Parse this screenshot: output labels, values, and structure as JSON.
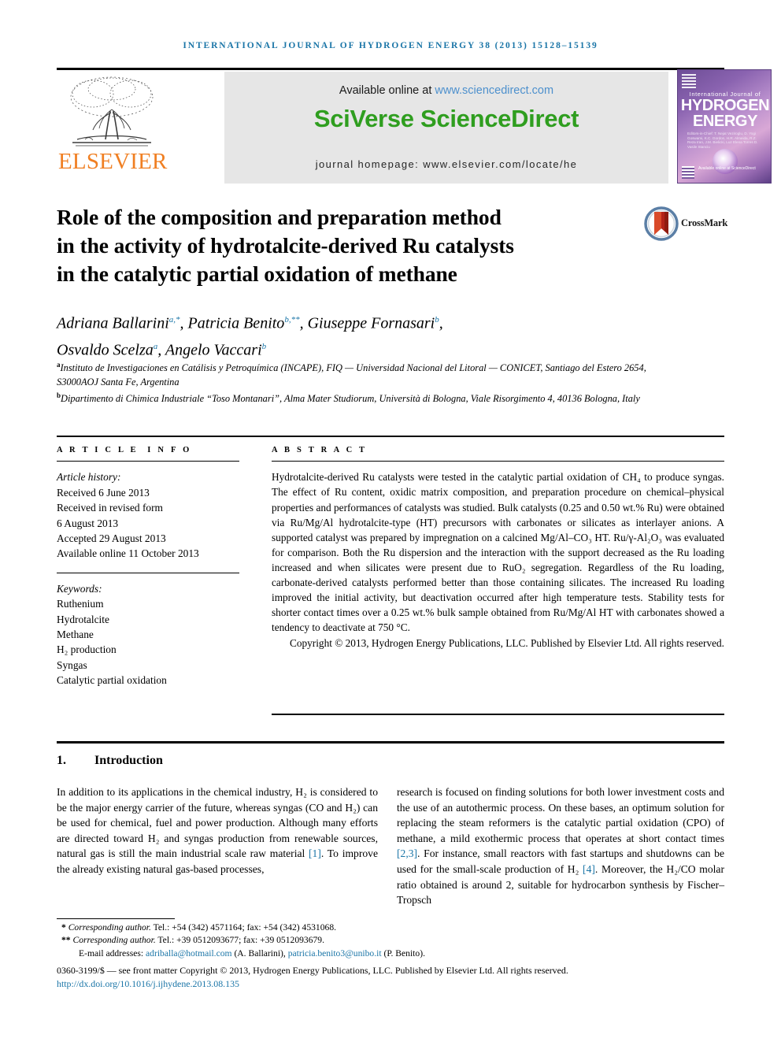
{
  "running_head": "International Journal of Hydrogen Energy 38 (2013) 15128–15139",
  "masthead": {
    "publisher_wordmark": "ELSEVIER",
    "available_label": "Available online at",
    "available_url": "www.sciencedirect.com",
    "platform_name": "SciVerse ScienceDirect",
    "homepage_line": "journal homepage: www.elsevier.com/locate/he",
    "cover": {
      "line1": "International Journal of",
      "line2": "HYDROGEN",
      "line3": "ENERGY",
      "editors": "Editors-in-Chief: T. Nejat Veziroglu, D. Yogi Goswami, K.C. Gordon, H.R. Almeida, R.Z. Reza Iran, J.M. Bielicki, Luz Elena Torres D. Vasile Stanciu",
      "publisher_note": "Available online at ScienceDirect"
    },
    "colors": {
      "elsevier_orange": "#F07F22",
      "sciverse_green": "#2f9e1f",
      "link_blue": "#4d90cd",
      "running_head_blue": "#1a75a7",
      "banner_gray": "#e6e6e6"
    }
  },
  "article": {
    "title_line1": "Role of the composition and preparation method",
    "title_line2": "in the activity of hydrotalcite-derived Ru catalysts",
    "title_line3": "in the catalytic partial oxidation of methane",
    "crossmark_label": "CrossMark",
    "authors_line1": "Adriana Ballarini",
    "authors_sup1": "a,*",
    "authors_line1b": ", Patricia Benito",
    "authors_sup2": "b,**",
    "authors_line1c": ", Giuseppe Fornasari",
    "authors_sup3": "b",
    "authors_line2": "Osvaldo Scelza",
    "authors_sup4": "a",
    "authors_line2b": ", Angelo Vaccari",
    "authors_sup5": "b",
    "affiliation_a_mark": "a",
    "affiliation_a": "Instituto de Investigaciones en Catálisis y Petroquímica (INCAPE), FIQ — Universidad Nacional del Litoral — CONICET, Santiago del Estero 2654, S3000AOJ Santa Fe, Argentina",
    "affiliation_b_mark": "b",
    "affiliation_b": "Dipartimento di Chimica Industriale “Toso Montanari”, Alma Mater Studiorum, Università di Bologna, Viale Risorgimento 4, 40136 Bologna, Italy"
  },
  "info": {
    "heading": "ARTICLE INFO",
    "history_label": "Article history:",
    "history": [
      "Received 6 June 2013",
      "Received in revised form",
      "6 August 2013",
      "Accepted 29 August 2013",
      "Available online 11 October 2013"
    ],
    "keywords_label": "Keywords:",
    "keywords": [
      "Ruthenium",
      "Hydrotalcite",
      "Methane",
      "H₂ production",
      "Syngas",
      "Catalytic partial oxidation"
    ]
  },
  "abstract": {
    "heading": "ABSTRACT",
    "text": "Hydrotalcite-derived Ru catalysts were tested in the catalytic partial oxidation of CH₄ to produce syngas. The effect of Ru content, oxidic matrix composition, and preparation procedure on chemical–physical properties and performances of catalysts was studied. Bulk catalysts (0.25 and 0.50 wt.% Ru) were obtained via Ru/Mg/Al hydrotalcite-type (HT) precursors with carbonates or silicates as interlayer anions. A supported catalyst was prepared by impregnation on a calcined Mg/Al–CO₃ HT. Ru/γ-Al₂O₃ was evaluated for comparison. Both the Ru dispersion and the interaction with the support decreased as the Ru loading increased and when silicates were present due to RuO₂ segregation. Regardless of the Ru loading, carbonate-derived catalysts performed better than those containing silicates. The increased Ru loading improved the initial activity, but deactivation occurred after high temperature tests. Stability tests for shorter contact times over a 0.25 wt.% bulk sample obtained from Ru/Mg/Al HT with carbonates showed a tendency to deactivate at 750 °C.",
    "copyright": "Copyright © 2013, Hydrogen Energy Publications, LLC. Published by Elsevier Ltd. All rights reserved."
  },
  "body": {
    "section_number": "1.",
    "section_title": "Introduction",
    "left_paragraph_1": "In addition to its applications in the chemical industry, H₂ is considered to be the major energy carrier of the future, whereas syngas (CO and H₂) can be used for chemical, fuel and power production. Although many efforts are directed toward H₂ and syngas production from renewable sources, natural gas is still the main industrial scale raw material ",
    "left_ref_1": "[1]",
    "left_paragraph_2": ". To improve the already existing natural gas-based processes,",
    "right_paragraph_1": "research is focused on finding solutions for both lower investment costs and the use of an autothermic process. On these bases, an optimum solution for replacing the steam reformers is the catalytic partial oxidation (CPO) of methane, a mild exothermic process that operates at short contact times ",
    "right_ref_1": "[2,3]",
    "right_paragraph_2": ". For instance, small reactors with fast startups and shutdowns can be used for the small-scale production of H₂ ",
    "right_ref_2": "[4]",
    "right_paragraph_3": ". Moreover, the H₂/CO molar ratio obtained is around 2, suitable for hydrocarbon synthesis by Fischer–Tropsch"
  },
  "footnotes": {
    "corresponding_1_mark": "*",
    "corresponding_1_label": "Corresponding author.",
    "corresponding_1_text": " Tel.: +54 (342) 4571164; fax: +54 (342) 4531068.",
    "corresponding_2_mark": "**",
    "corresponding_2_label": "Corresponding author.",
    "corresponding_2_text": " Tel.: +39 0512093677; fax: +39 0512093679.",
    "email_label": "E-mail addresses:",
    "email_1": "adriballa@hotmail.com",
    "email_1_owner": "(A. Ballarini),",
    "email_2": "patricia.benito3@unibo.it",
    "email_2_owner": "(P. Benito).",
    "issn_line": "0360-3199/$ — see front matter Copyright © 2013, Hydrogen Energy Publications, LLC. Published by Elsevier Ltd. All rights reserved.",
    "doi": "http://dx.doi.org/10.1016/j.ijhydene.2013.08.135"
  }
}
